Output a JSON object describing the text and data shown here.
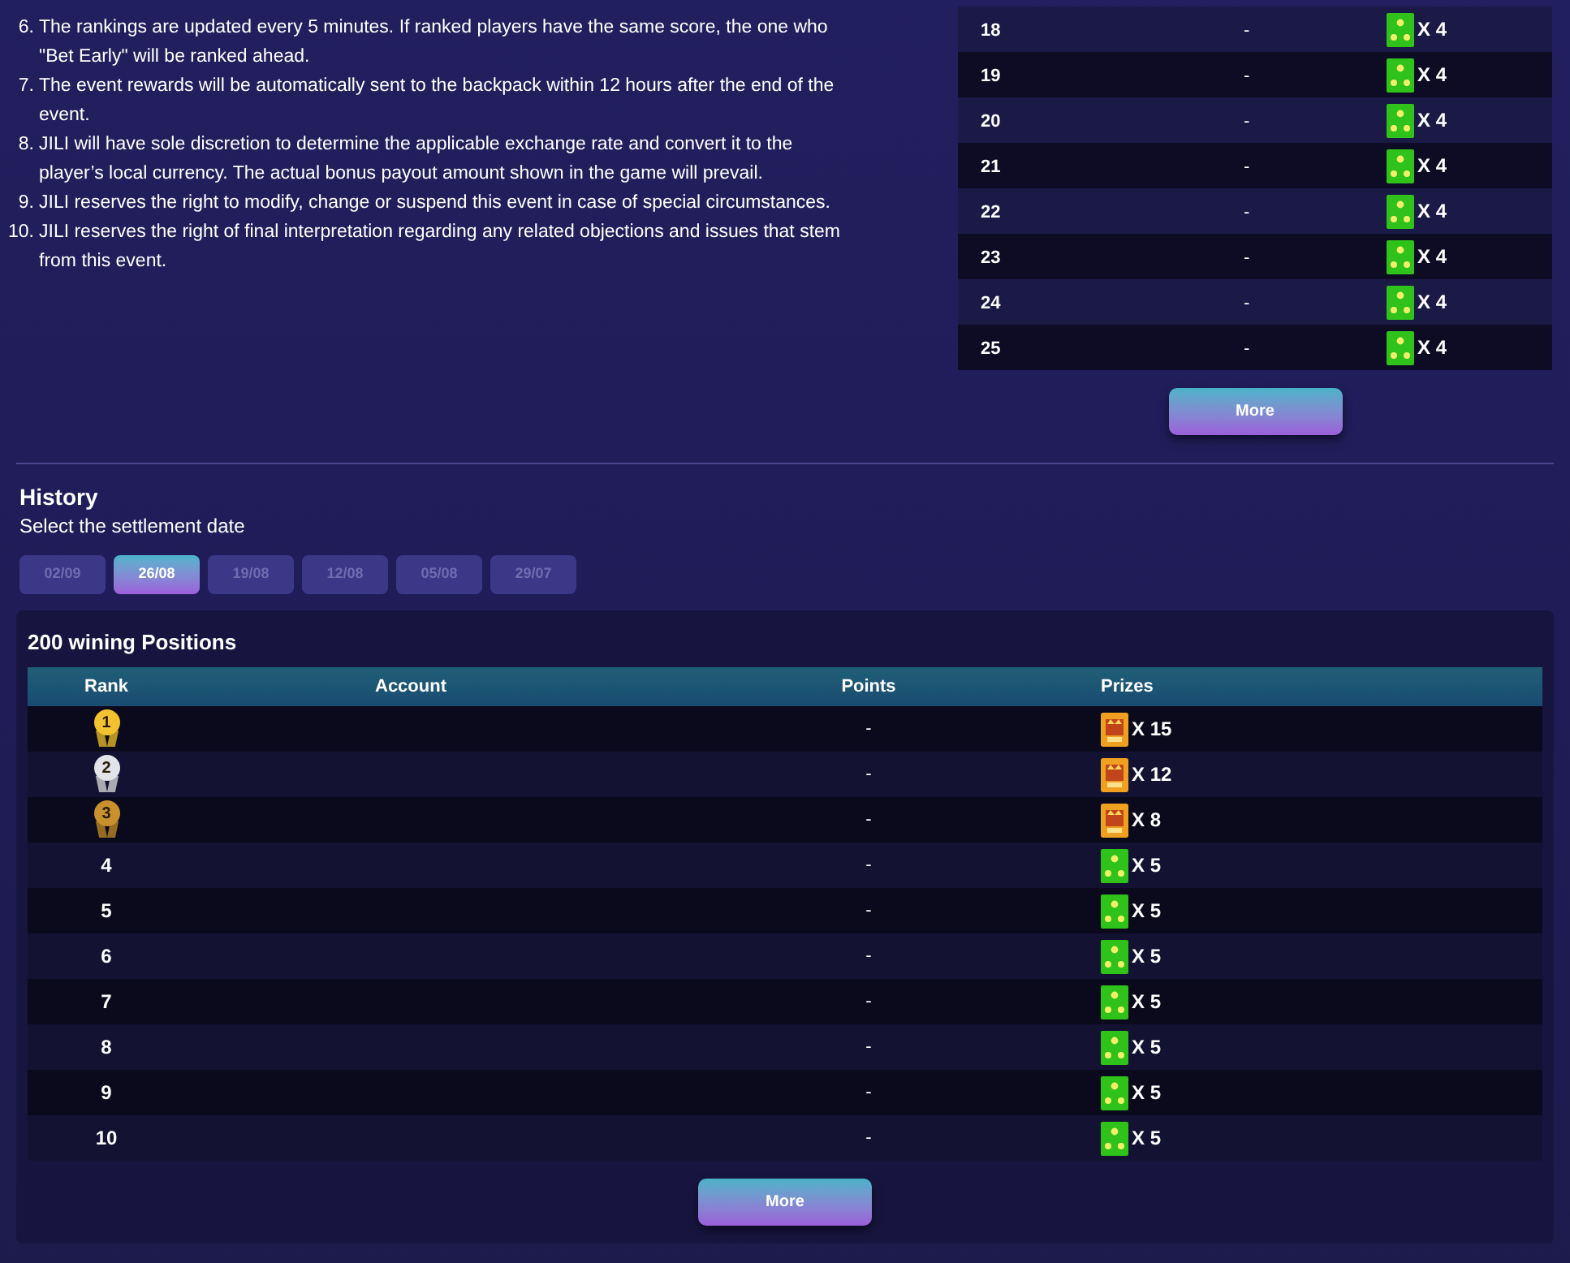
{
  "rules": [
    {
      "number": "6.",
      "text": "The rankings are updated every 5 minutes. If ranked players have the same score, the one who \"Bet Early\" will be ranked ahead."
    },
    {
      "number": "7.",
      "text": "The event rewards will be automatically sent to the backpack within 12 hours after the end of the event."
    },
    {
      "number": "8.",
      "text": "JILI will have sole discretion to determine the applicable exchange rate and convert it to the player’s local currency. The actual bonus payout amount shown in the game will prevail."
    },
    {
      "number": "9.",
      "text": "JILI reserves the right to modify, change or suspend this event in case of special circumstances."
    },
    {
      "number": "10.",
      "text": "JILI reserves the right of final interpretation regarding any related objections and issues that stem from this event."
    }
  ],
  "current_table": {
    "rows": [
      {
        "rank": "18",
        "points": "-",
        "prize": {
          "kind": "stars",
          "count": "X 4"
        }
      },
      {
        "rank": "19",
        "points": "-",
        "prize": {
          "kind": "stars",
          "count": "X 4"
        }
      },
      {
        "rank": "20",
        "points": "-",
        "prize": {
          "kind": "stars",
          "count": "X 4"
        }
      },
      {
        "rank": "21",
        "points": "-",
        "prize": {
          "kind": "stars",
          "count": "X 4"
        }
      },
      {
        "rank": "22",
        "points": "-",
        "prize": {
          "kind": "stars",
          "count": "X 4"
        }
      },
      {
        "rank": "23",
        "points": "-",
        "prize": {
          "kind": "stars",
          "count": "X 4"
        }
      },
      {
        "rank": "24",
        "points": "-",
        "prize": {
          "kind": "stars",
          "count": "X 4"
        }
      },
      {
        "rank": "25",
        "points": "-",
        "prize": {
          "kind": "stars",
          "count": "X 4"
        }
      }
    ],
    "more_button": "More"
  },
  "history": {
    "title": "History",
    "subtitle": "Select the settlement date",
    "dates": [
      {
        "label": "02/09",
        "selected": false
      },
      {
        "label": "26/08",
        "selected": true
      },
      {
        "label": "19/08",
        "selected": false
      },
      {
        "label": "12/08",
        "selected": false
      },
      {
        "label": "05/08",
        "selected": false
      },
      {
        "label": "29/07",
        "selected": false
      }
    ],
    "card_title": "200 wining Positions",
    "columns": [
      "Rank",
      "Account",
      "Points",
      "Prizes"
    ],
    "rows": [
      {
        "rank": {
          "kind": "medal",
          "label": "1",
          "color": "#f2c230"
        },
        "points": "-",
        "prize": {
          "kind": "crate",
          "count": "X 15"
        }
      },
      {
        "rank": {
          "kind": "medal",
          "label": "2",
          "color": "#e2e4ea"
        },
        "points": "-",
        "prize": {
          "kind": "crate",
          "count": "X 12"
        }
      },
      {
        "rank": {
          "kind": "medal",
          "label": "3",
          "color": "#c9902e"
        },
        "points": "-",
        "prize": {
          "kind": "crate",
          "count": "X 8"
        }
      },
      {
        "rank": {
          "kind": "number",
          "label": "4"
        },
        "points": "-",
        "prize": {
          "kind": "stars",
          "count": "X 5"
        }
      },
      {
        "rank": {
          "kind": "number",
          "label": "5"
        },
        "points": "-",
        "prize": {
          "kind": "stars",
          "count": "X 5"
        }
      },
      {
        "rank": {
          "kind": "number",
          "label": "6"
        },
        "points": "-",
        "prize": {
          "kind": "stars",
          "count": "X 5"
        }
      },
      {
        "rank": {
          "kind": "number",
          "label": "7"
        },
        "points": "-",
        "prize": {
          "kind": "stars",
          "count": "X 5"
        }
      },
      {
        "rank": {
          "kind": "number",
          "label": "8"
        },
        "points": "-",
        "prize": {
          "kind": "stars",
          "count": "X 5"
        }
      },
      {
        "rank": {
          "kind": "number",
          "label": "9"
        },
        "points": "-",
        "prize": {
          "kind": "stars",
          "count": "X 5"
        }
      },
      {
        "rank": {
          "kind": "number",
          "label": "10"
        },
        "points": "-",
        "prize": {
          "kind": "stars",
          "count": "X 5"
        }
      }
    ],
    "more_button": "More"
  }
}
